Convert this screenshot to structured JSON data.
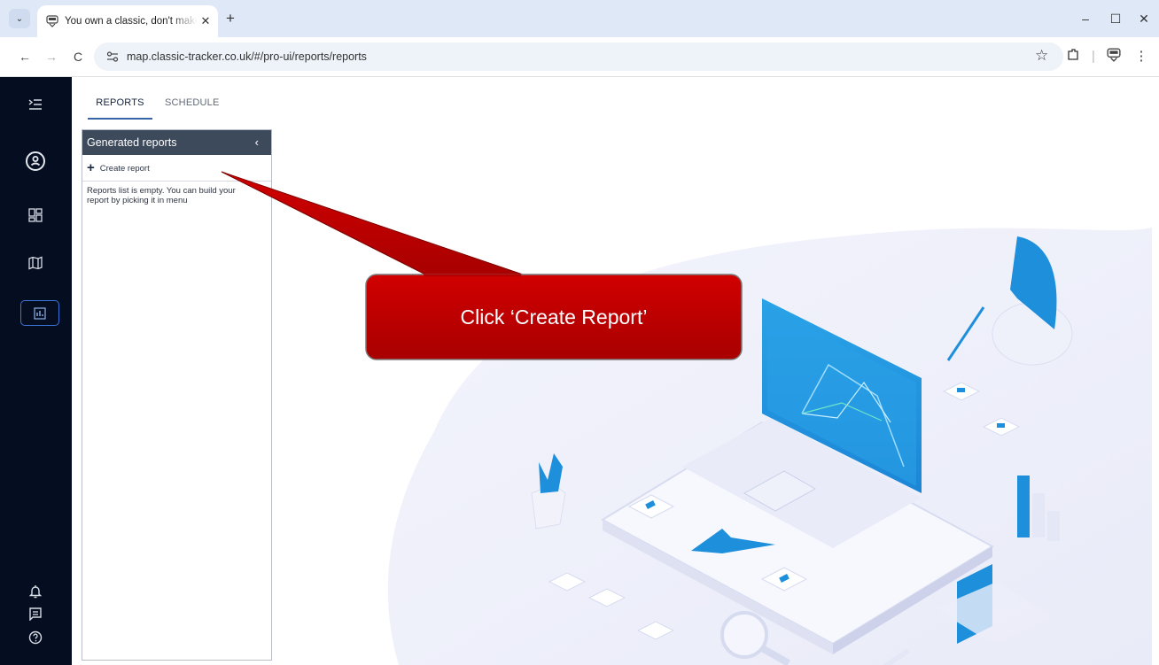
{
  "browser": {
    "tab_title": "You own a classic, don't make it",
    "tab_close": "✕",
    "new_tab": "+",
    "url": "map.classic-tracker.co.uk/#/pro-ui/reports/reports",
    "window_controls": {
      "minimize": "–",
      "maximize": "☐",
      "close": "✕"
    },
    "nav": {
      "back": "←",
      "forward": "→",
      "reload": "C"
    }
  },
  "sidebar": {
    "icons": [
      "menu-collapse-icon",
      "user-profile-icon",
      "dashboard-icon",
      "map-icon",
      "reports-icon",
      "notification-bell-icon",
      "chat-icon",
      "help-icon"
    ],
    "active": "reports-icon"
  },
  "page_tabs": {
    "reports": "REPORTS",
    "schedule": "SCHEDULE",
    "active": "REPORTS"
  },
  "panel": {
    "title": "Generated reports",
    "collapse_glyph": "‹",
    "create_label": "Create report",
    "empty_message": "Reports list is empty. You can build your report by picking it in menu"
  },
  "callout": {
    "text": "Click ‘Create Report’",
    "color": "#c00000"
  },
  "colors": {
    "sidebar_bg": "#050e20",
    "panel_header_bg": "#3d4a5c",
    "accent": "#3564a8"
  }
}
